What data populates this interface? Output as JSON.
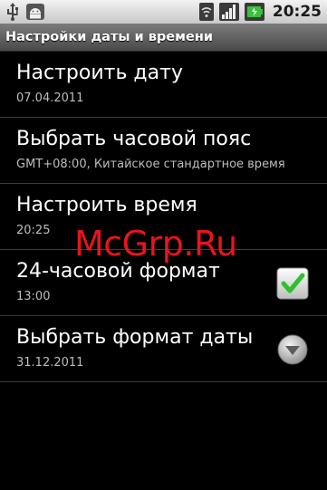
{
  "status_bar": {
    "time": "20:25",
    "icons": [
      "usb-icon",
      "android-debug-icon",
      "wifi-icon",
      "signal-icon",
      "battery-icon"
    ]
  },
  "screen": {
    "title": "Настройки даты и времени"
  },
  "settings": {
    "items": [
      {
        "title": "Настроить дату",
        "summary": "07.04.2011"
      },
      {
        "title": "Выбрать часовой пояс",
        "summary": "GMT+08:00, Китайское стандартное время"
      },
      {
        "title": "Настроить время",
        "summary": "20:25"
      },
      {
        "title": "24-часовой формат",
        "summary": "13:00",
        "checked": true
      },
      {
        "title": "Выбрать формат даты",
        "summary": "31.12.2011"
      }
    ]
  },
  "watermark": "McGrp.Ru",
  "colors": {
    "accent_check": "#2fbf2f",
    "watermark": "#e8141c"
  }
}
